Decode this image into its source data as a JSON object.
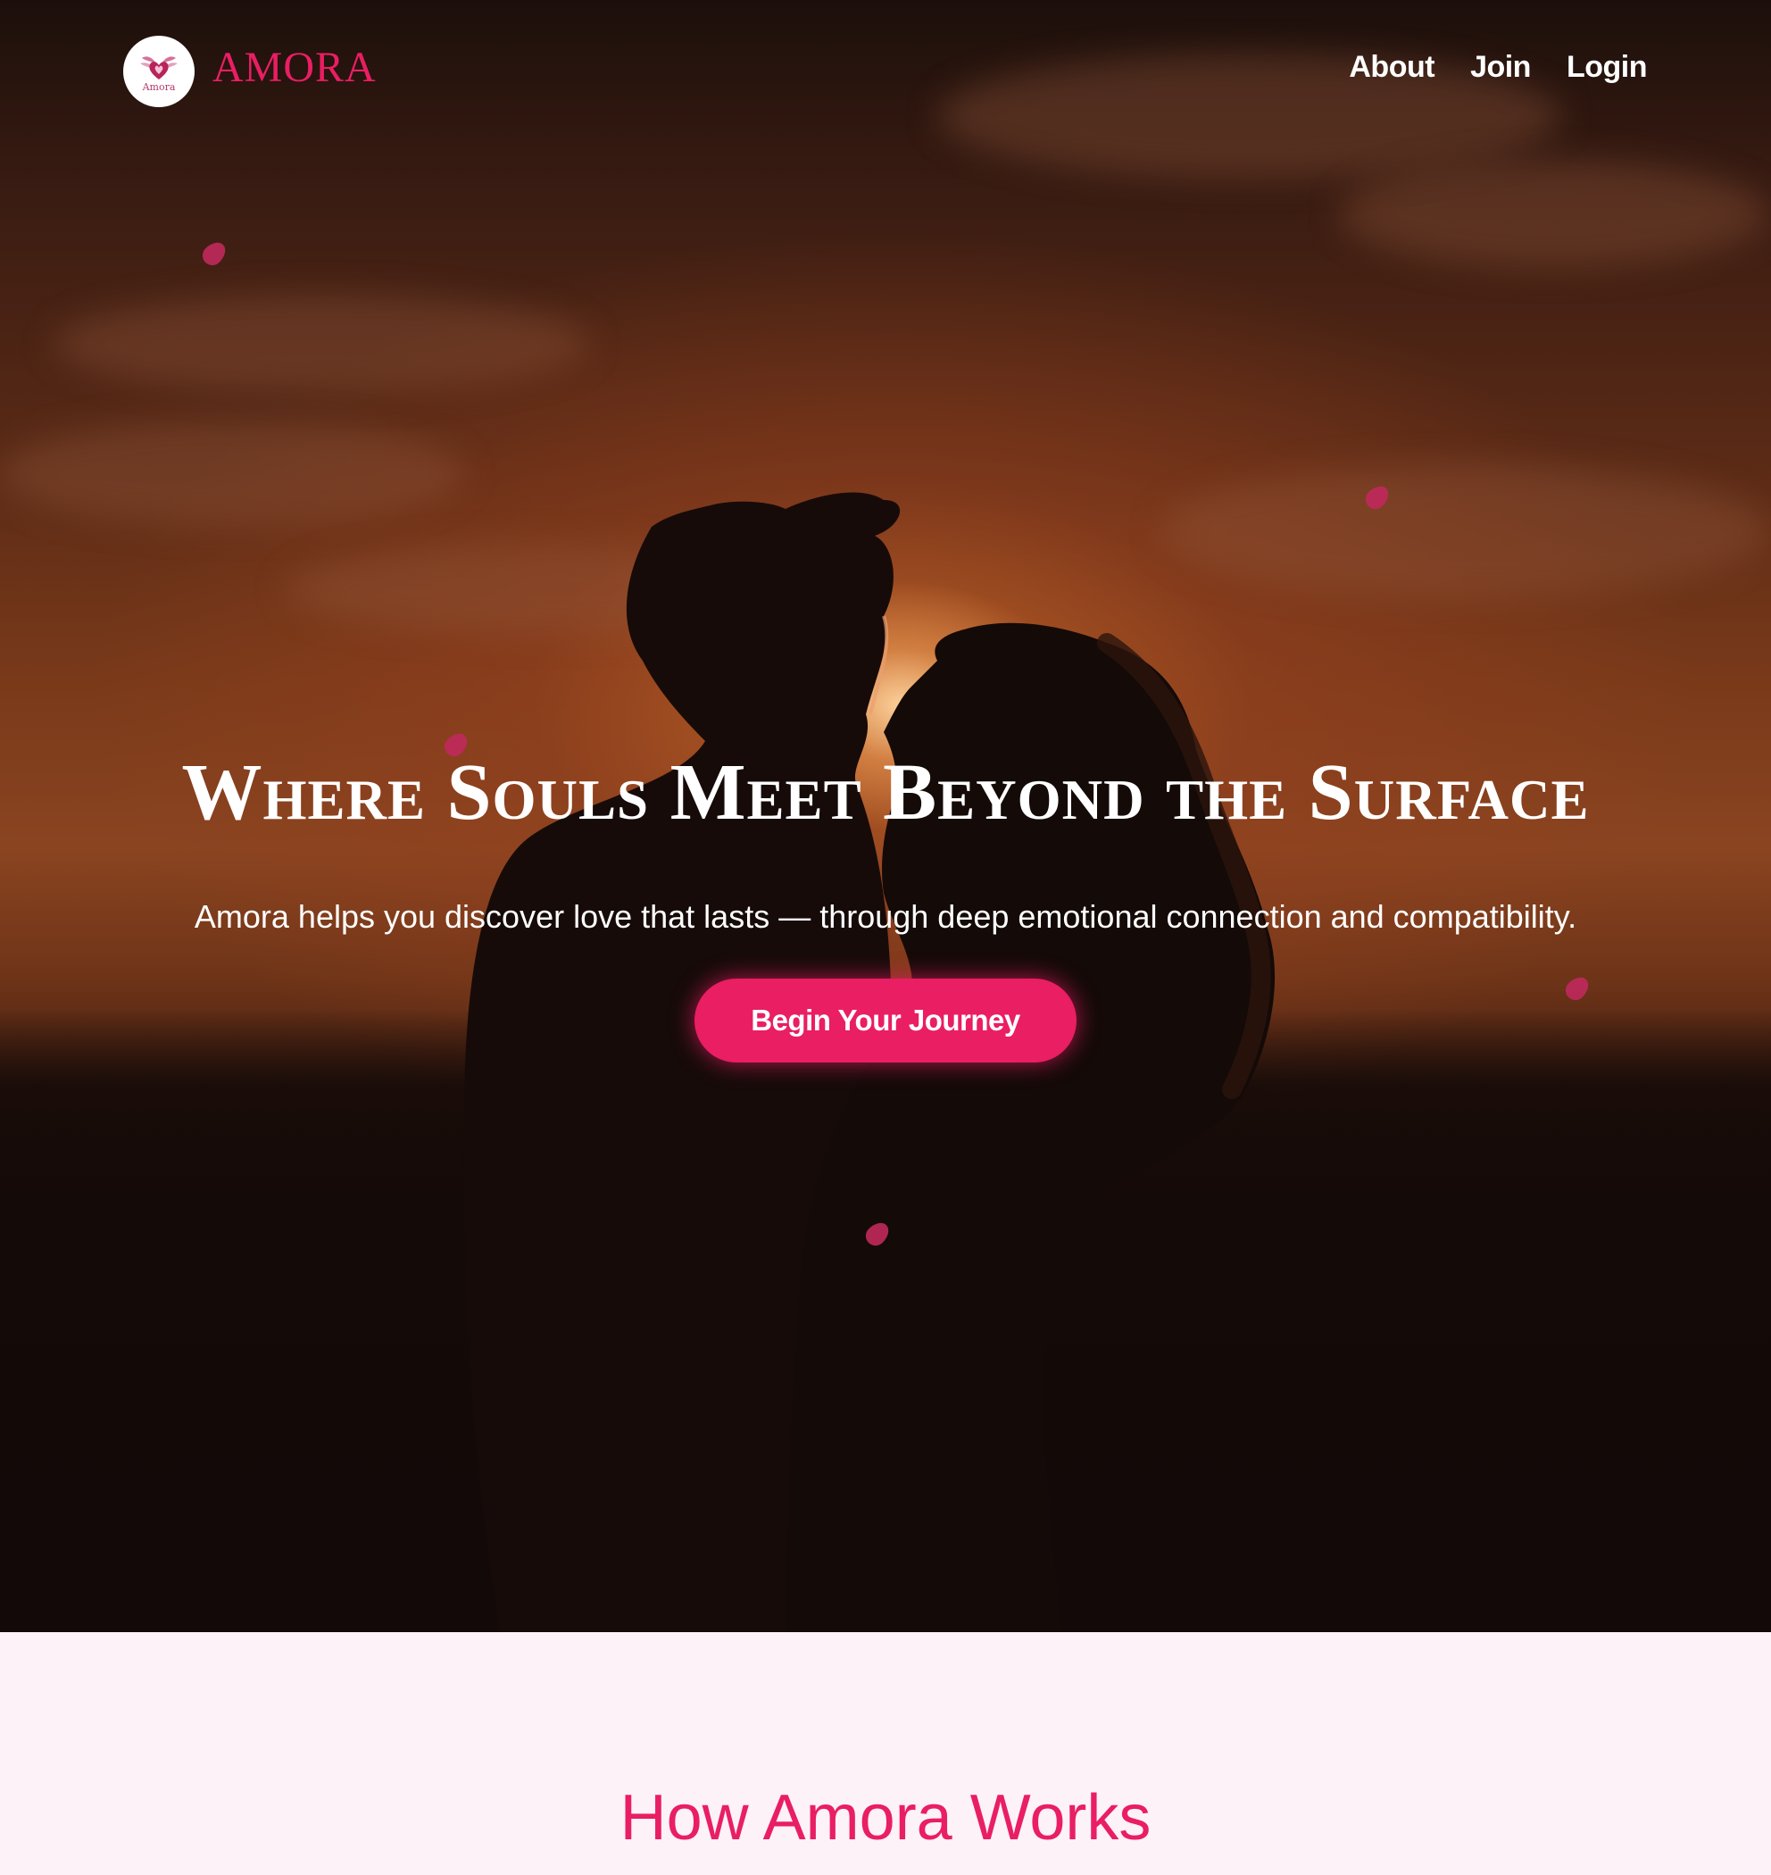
{
  "nav": {
    "logo_caption": "Amora",
    "brand": "AMORA",
    "links": [
      "About",
      "Join",
      "Login"
    ]
  },
  "hero": {
    "title": "Where Souls Meet Beyond the Surface",
    "subtitle": "Amora helps you discover love that lasts — through deep emotional connection and compatibility.",
    "cta_label": "Begin Your Journey"
  },
  "section": {
    "title": "How Amora Works"
  },
  "colors": {
    "accent": "#e91e63",
    "section_bg": "#fdf2f7",
    "petal": "#c0295c"
  },
  "icons": {
    "logo": "winged-heart-icon",
    "petals": "rose-petal-icon"
  }
}
